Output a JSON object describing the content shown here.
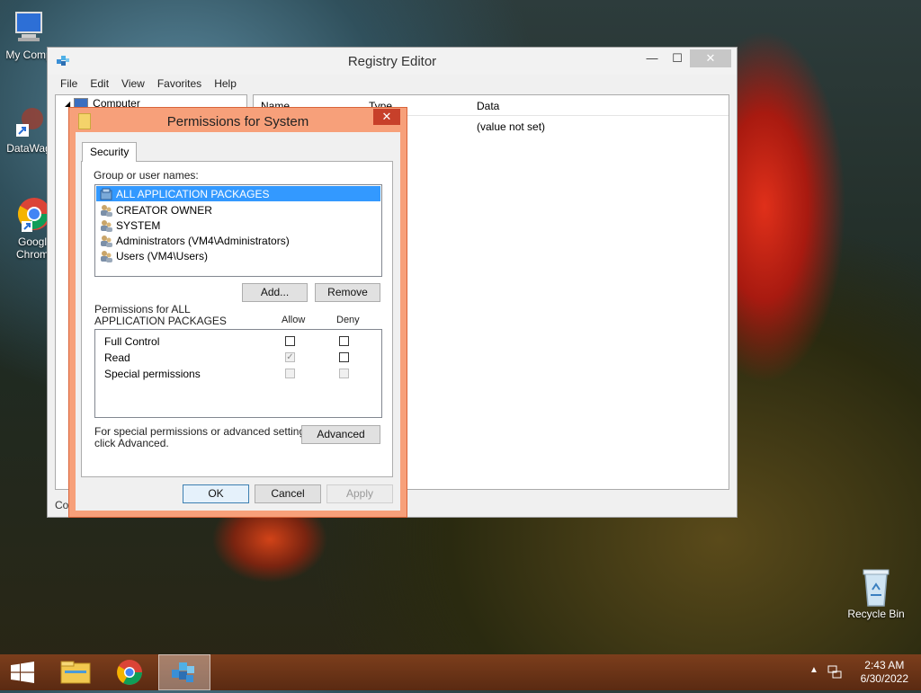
{
  "desktop": {
    "icons": [
      {
        "label": "My Comp"
      },
      {
        "label": "DataWag"
      },
      {
        "label": "Googl",
        "label2": "Chrom"
      },
      {
        "label": "Recycle Bin"
      }
    ]
  },
  "registry": {
    "title": "Registry Editor",
    "menu": [
      "File",
      "Edit",
      "View",
      "Favorites",
      "Help"
    ],
    "tree_root": "Computer",
    "columns": [
      "Name",
      "Type",
      "Data"
    ],
    "row_data": "(value not set)",
    "status": "Co"
  },
  "permissions": {
    "title": "Permissions for System",
    "tab": "Security",
    "group_label": "Group or user names:",
    "users": [
      "ALL APPLICATION PACKAGES",
      "CREATOR OWNER",
      "SYSTEM",
      "Administrators (VM4\\Administrators)",
      "Users (VM4\\Users)"
    ],
    "selected_user_index": 0,
    "add_label": "Add...",
    "remove_label": "Remove",
    "perm_header_line1": "Permissions for ALL",
    "perm_header_line2": "APPLICATION PACKAGES",
    "allow_label": "Allow",
    "deny_label": "Deny",
    "permissions": [
      {
        "name": "Full Control",
        "allow": false,
        "deny": false,
        "disabled": false
      },
      {
        "name": "Read",
        "allow": true,
        "deny": false,
        "disabled": false,
        "allow_disabled": true
      },
      {
        "name": "Special permissions",
        "allow": false,
        "deny": false,
        "disabled": true
      }
    ],
    "special_text_line1": "For special permissions or advanced settings,",
    "special_text_line2": "click Advanced.",
    "advanced_label": "Advanced",
    "ok_label": "OK",
    "cancel_label": "Cancel",
    "apply_label": "Apply"
  },
  "taskbar": {
    "time": "2:43 AM",
    "date": "6/30/2022"
  },
  "colors": {
    "selection": "#3399ff",
    "dialog_frame": "#f7a07a",
    "taskbar": "#6b3418"
  }
}
